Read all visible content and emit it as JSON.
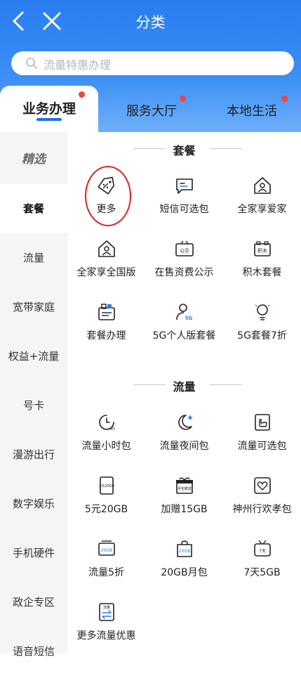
{
  "header": {
    "title": "分类",
    "back_icon": "chevron-left-icon",
    "close_icon": "close-icon"
  },
  "search": {
    "placeholder": "流量特惠办理"
  },
  "tabs": [
    {
      "label": "业务办理",
      "active": true
    },
    {
      "label": "服务大厅",
      "active": false
    },
    {
      "label": "本地生活",
      "active": false
    }
  ],
  "sidebar": {
    "items": [
      {
        "label": "精选"
      },
      {
        "label": "套餐"
      },
      {
        "label": "流量"
      },
      {
        "label": "宽带家庭"
      },
      {
        "label": "权益+流量"
      },
      {
        "label": "号卡"
      },
      {
        "label": "漫游出行"
      },
      {
        "label": "数字娱乐"
      },
      {
        "label": "手机硬件"
      },
      {
        "label": "政企专区"
      },
      {
        "label": "语音短信"
      }
    ]
  },
  "sections": [
    {
      "title": "套餐",
      "items": [
        {
          "label": "更多",
          "icon": "tag-icon"
        },
        {
          "label": "短信可选包",
          "icon": "message-icon"
        },
        {
          "label": "全家享爱家",
          "icon": "home-user-icon"
        },
        {
          "label": "全家享全国版",
          "icon": "home-user-icon"
        },
        {
          "label": "在售资费公示",
          "icon": "notice-board-icon",
          "icon_text": "公示"
        },
        {
          "label": "积木套餐",
          "icon": "blocks-icon",
          "icon_text": "积木"
        },
        {
          "label": "套餐办理",
          "icon": "package-icon"
        },
        {
          "label": "5G个人版套餐",
          "icon": "user-5g-icon",
          "icon_text": "5G"
        },
        {
          "label": "5G套餐7折",
          "icon": "lightbulb-icon"
        }
      ]
    },
    {
      "title": "流量",
      "items": [
        {
          "label": "流量小时包",
          "icon": "clock-4h-icon",
          "icon_text": "4h"
        },
        {
          "label": "流量夜间包",
          "icon": "moon-icon"
        },
        {
          "label": "流量可选包",
          "icon": "hand-card-icon"
        },
        {
          "label": "5元20GB",
          "icon": "data-card-icon",
          "icon_text": "5元20GB"
        },
        {
          "label": "加赠15GB",
          "icon": "gift-icon",
          "icon_text": "月包赠送"
        },
        {
          "label": "神州行欢孝包",
          "icon": "heart-card-icon"
        },
        {
          "label": "流量5折",
          "icon": "discount-card-icon",
          "icon_text": "20GB"
        },
        {
          "label": "20GB月包",
          "icon": "shopping-bag-icon",
          "icon_text": "20GB"
        },
        {
          "label": "7天5GB",
          "icon": "tv-7day-icon",
          "icon_text": "7天"
        },
        {
          "label": "更多流量优惠",
          "icon": "swap-card-icon",
          "icon_text": "流量"
        }
      ]
    }
  ],
  "colors": {
    "primary": "#2a7df0",
    "accent_red": "#f0463c",
    "highlight_circle": "#e02020"
  }
}
